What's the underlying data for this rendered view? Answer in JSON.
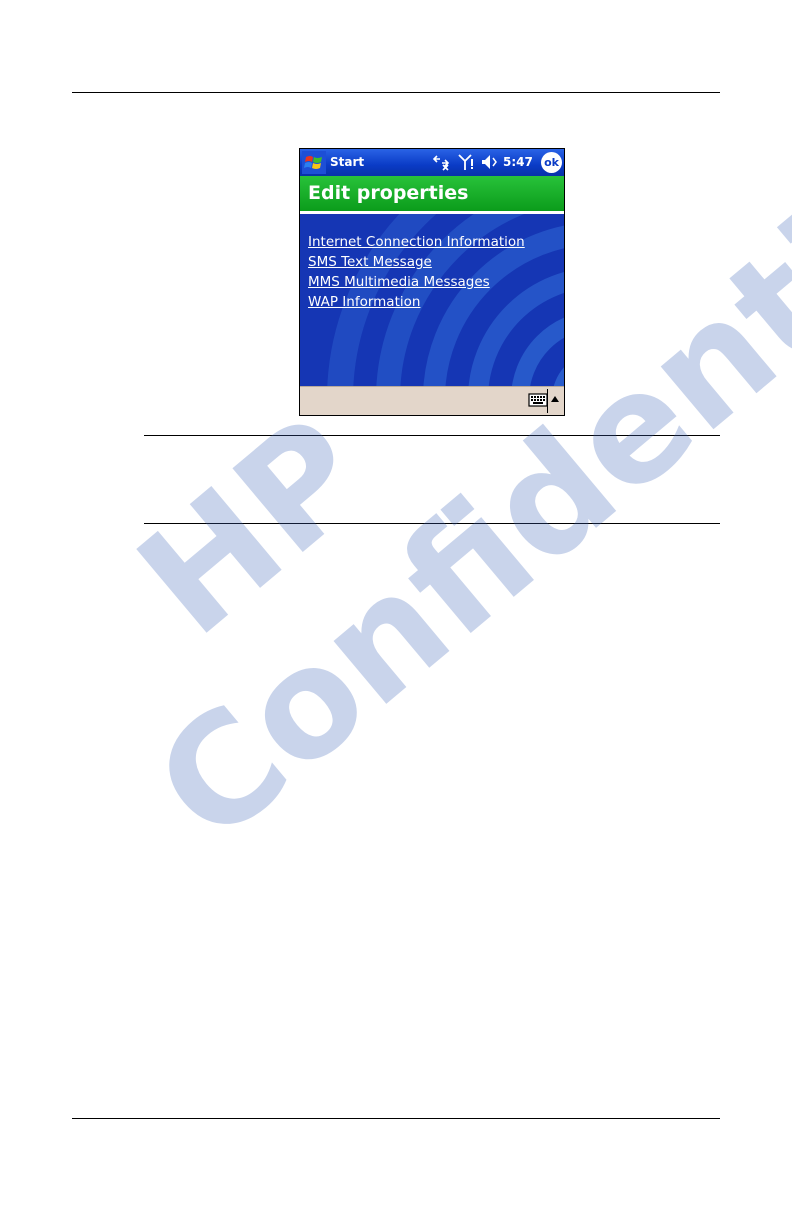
{
  "titlebar": {
    "start_label": "Start",
    "clock": "5:47",
    "ok_label": "ok",
    "icons": [
      "windows-flag-icon",
      "connectivity-icon",
      "signal-icon",
      "speaker-icon"
    ]
  },
  "header": {
    "title": "Edit properties"
  },
  "links": [
    {
      "label": "Internet Connection Information"
    },
    {
      "label": "SMS Text Message"
    },
    {
      "label": "MMS Multimedia Messages"
    },
    {
      "label": "WAP Information"
    }
  ],
  "bottombar": {
    "icons": [
      "keyboard-icon",
      "sip-arrow-icon"
    ]
  },
  "watermark": {
    "line1": "HP",
    "line2": "Confidential"
  },
  "colors": {
    "titlebar": "#0a3bc6",
    "header": "#18ad28",
    "background": "#1536b4",
    "bottombar": "#e3d6ca",
    "watermark": "#3f67ba"
  }
}
